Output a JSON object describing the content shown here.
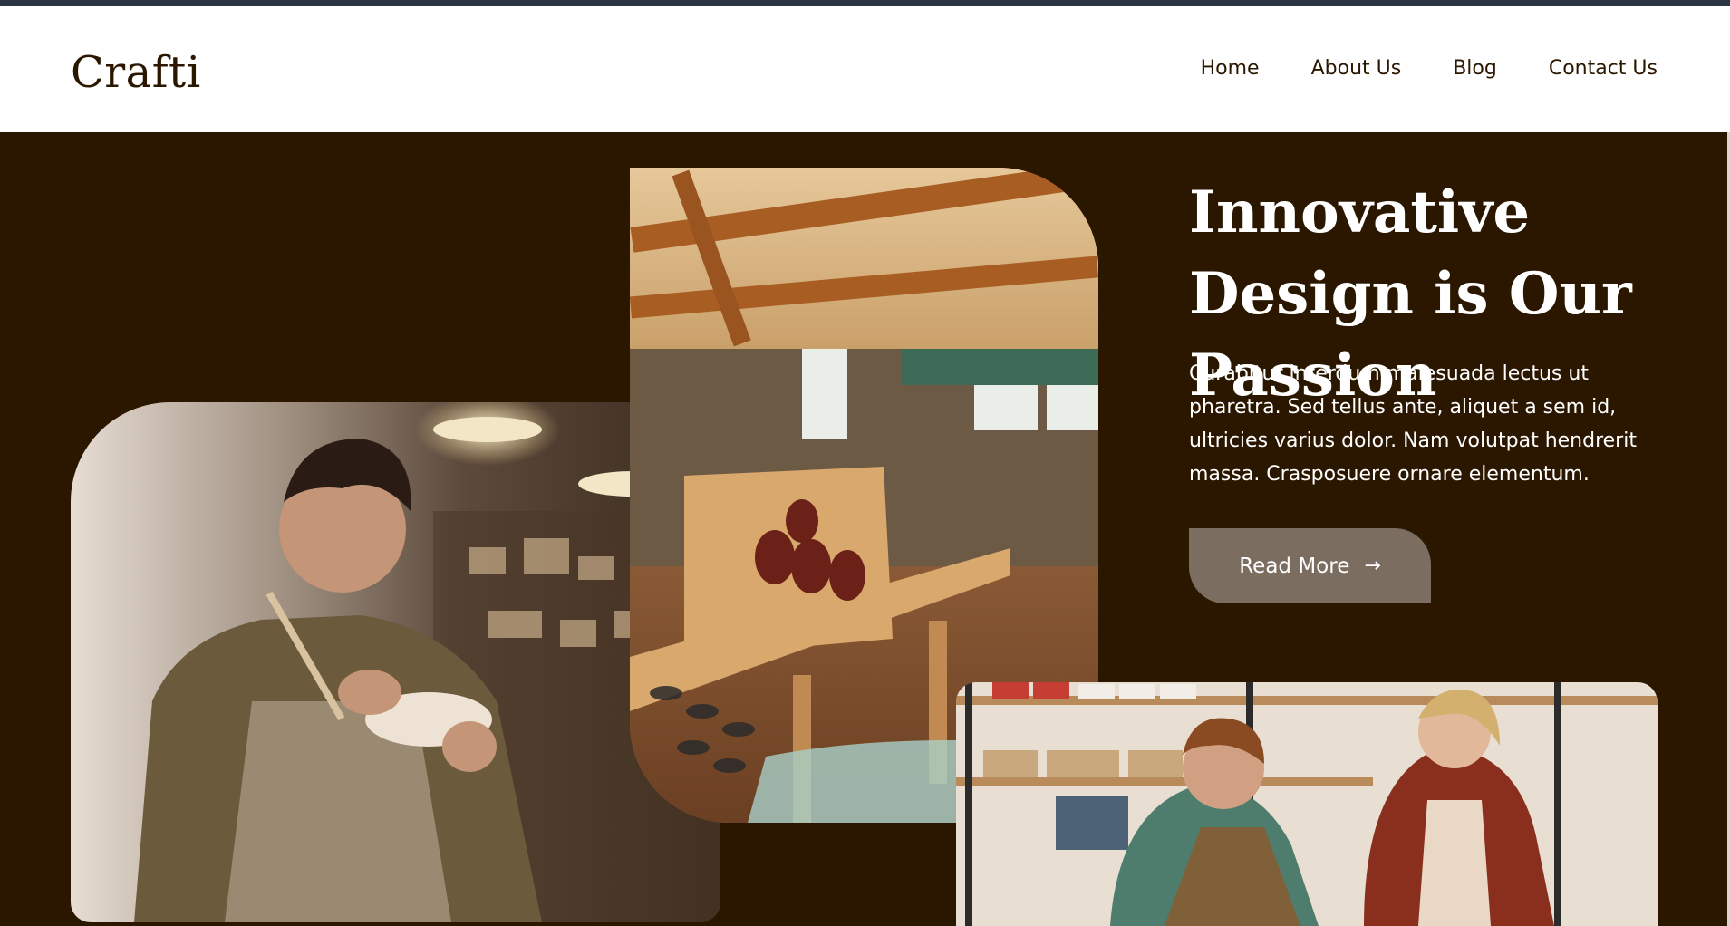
{
  "brand": {
    "logo_text": "Crafti"
  },
  "nav": {
    "items": [
      {
        "label": "Home"
      },
      {
        "label": "About Us"
      },
      {
        "label": "Blog"
      },
      {
        "label": "Contact Us"
      }
    ]
  },
  "hero": {
    "headline": "Innovative Design is Our Passion",
    "body": "Curabitur interdum malesuada lectus ut pharetra. Sed tellus ante, aliquet a sem id, ultricies varius dolor. Nam volutpat hendrerit massa. Crasposuere ornare elementum.",
    "cta_label": "Read More",
    "cta_icon": "arrow-right-icon"
  },
  "colors": {
    "background": "#2b1700",
    "button": "#7b6e61",
    "header_bg": "#ffffff",
    "topbar": "#2c3442"
  }
}
